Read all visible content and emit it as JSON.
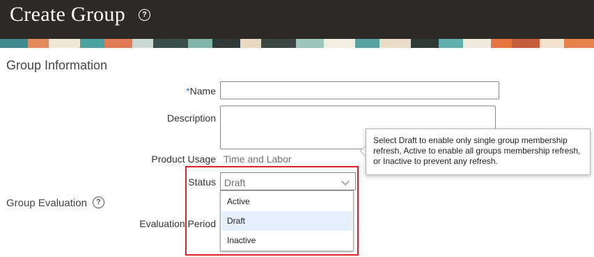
{
  "header": {
    "title": "Create Group",
    "help_icon": "question-circle-icon"
  },
  "group_information": {
    "title": "Group Information",
    "name_required_mark": "*",
    "name_label": "Name",
    "name_value": "",
    "description_label": "Description",
    "description_value": "",
    "product_usage_label": "Product Usage",
    "product_usage_value": "Time and Labor",
    "status_label": "Status",
    "status_value": "Draft",
    "status_options": [
      "Active",
      "Draft",
      "Inactive"
    ]
  },
  "tooltip": {
    "text": "Select Draft to enable only single group membership refresh, Active to enable all groups membership refresh, or Inactive to prevent any refresh."
  },
  "group_evaluation": {
    "title": "Group Evaluation",
    "evaluation_period_label": "Evaluation Period"
  },
  "colors": {
    "header_bg": "#2f2a27",
    "highlight_red": "#e2202a",
    "selected_option_bg": "#e4f0fb",
    "required_blue": "#2b6fb3"
  }
}
